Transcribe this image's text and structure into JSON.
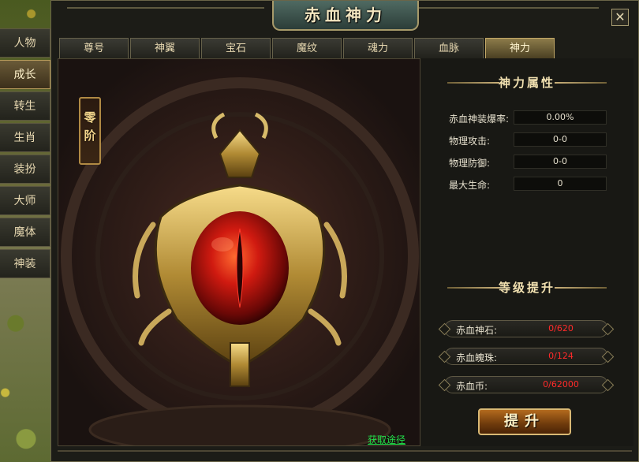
{
  "window": {
    "title": "赤血神力",
    "close_label": "✕"
  },
  "side_menu": {
    "items": [
      {
        "label": "人物",
        "active": false
      },
      {
        "label": "成长",
        "active": true
      },
      {
        "label": "转生",
        "active": false
      },
      {
        "label": "生肖",
        "active": false
      },
      {
        "label": "装扮",
        "active": false
      },
      {
        "label": "大师",
        "active": false
      },
      {
        "label": "魔体",
        "active": false
      },
      {
        "label": "神装",
        "active": false
      }
    ]
  },
  "tabs": [
    {
      "label": "尊号",
      "active": false
    },
    {
      "label": "神翼",
      "active": false
    },
    {
      "label": "宝石",
      "active": false
    },
    {
      "label": "魔纹",
      "active": false
    },
    {
      "label": "魂力",
      "active": false
    },
    {
      "label": "血脉",
      "active": false
    },
    {
      "label": "神力",
      "active": true
    }
  ],
  "art": {
    "rank_label": "零阶",
    "get_link": "获取途径"
  },
  "attributes": {
    "header": "神力属性",
    "rows": [
      {
        "label": "赤血神装爆率:",
        "value": "0.00%"
      },
      {
        "label": "物理攻击:",
        "value": "0-0"
      },
      {
        "label": "物理防御:",
        "value": "0-0"
      },
      {
        "label": "最大生命:",
        "value": "0"
      }
    ]
  },
  "upgrade": {
    "header": "等级提升",
    "resources": [
      {
        "label": "赤血神石:",
        "value": "0/620"
      },
      {
        "label": "赤血魄珠:",
        "value": "0/124"
      },
      {
        "label": "赤血币:",
        "value": "0/62000"
      }
    ],
    "button_label": "提升"
  },
  "colors": {
    "accent": "#c4a968",
    "resource_value": "#ff2a2a",
    "link": "#22e04a"
  }
}
